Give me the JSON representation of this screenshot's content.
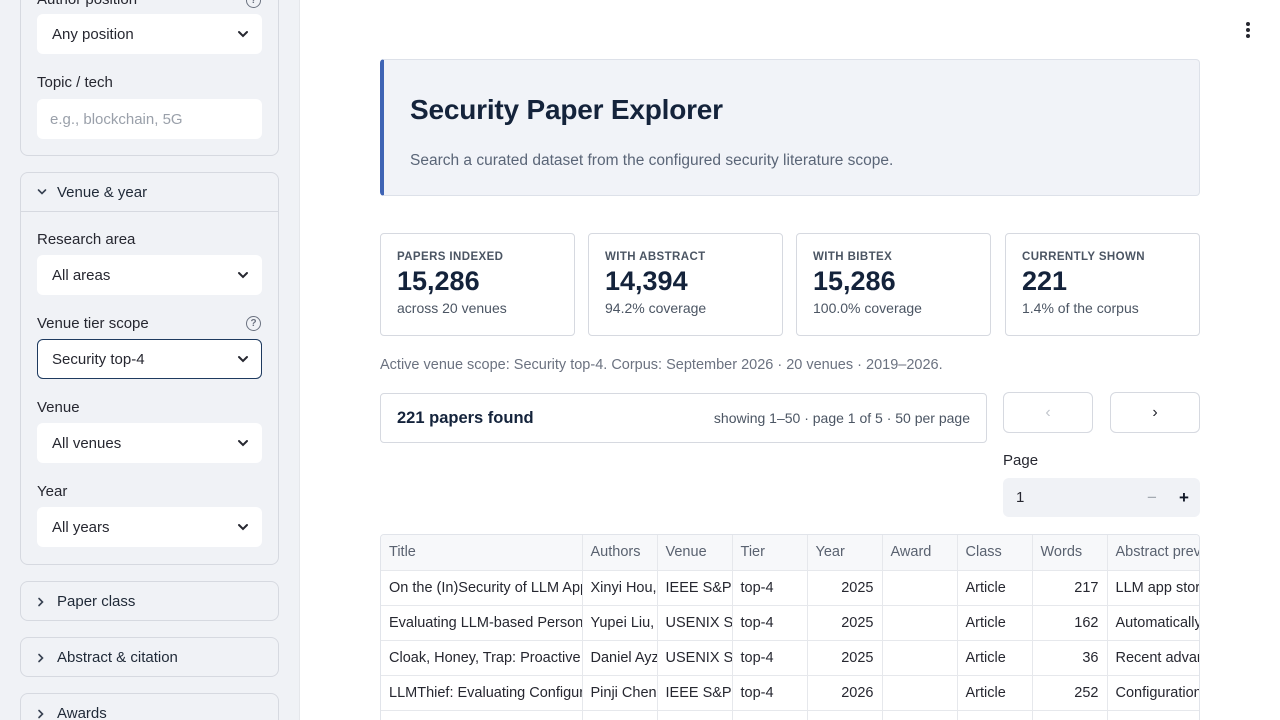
{
  "sidebar": {
    "author_position": {
      "label": "Author position",
      "value": "Any position"
    },
    "topic": {
      "label": "Topic / tech",
      "placeholder": "e.g., blockchain, 5G"
    },
    "venue_year_section": {
      "label": "Venue & year"
    },
    "research_area": {
      "label": "Research area",
      "value": "All areas"
    },
    "venue_tier": {
      "label": "Venue tier scope",
      "value": "Security top-4"
    },
    "venue": {
      "label": "Venue",
      "value": "All venues"
    },
    "year": {
      "label": "Year",
      "value": "All years"
    },
    "collapsed_sections": [
      "Paper class",
      "Abstract & citation",
      "Awards"
    ]
  },
  "header": {
    "title": "Security Paper Explorer",
    "subtitle": "Search a curated dataset from the configured security literature scope."
  },
  "stats": [
    {
      "label": "PAPERS INDEXED",
      "value": "15,286",
      "sub": "across 20 venues"
    },
    {
      "label": "WITH ABSTRACT",
      "value": "14,394",
      "sub": "94.2% coverage"
    },
    {
      "label": "WITH BIBTEX",
      "value": "15,286",
      "sub": "100.0% coverage"
    },
    {
      "label": "CURRENTLY SHOWN",
      "value": "221",
      "sub": "1.4% of the corpus"
    }
  ],
  "scope_note": "Active venue scope: Security top-4. Corpus: September 2026 · 20 venues · 2019–2026.",
  "results": {
    "count": "221 papers found",
    "meta": "showing 1–50 · page 1 of 5 · 50 per page"
  },
  "pagination": {
    "prev": "‹",
    "next": "›",
    "page_label": "Page",
    "page_value": "1",
    "minus": "−",
    "plus": "+"
  },
  "table": {
    "columns": [
      "Title",
      "Authors",
      "Venue",
      "Tier",
      "Year",
      "Award",
      "Class",
      "Words",
      "Abstract preview"
    ],
    "rows": [
      [
        "On the (In)Security of LLM App Stores",
        "Xinyi Hou, Yanjie Zhao",
        "IEEE S&P",
        "top-4",
        "2025",
        "",
        "Article",
        "217",
        "LLM app stores have seen rapid growth"
      ],
      [
        "Evaluating LLM-based Personal Information Extraction",
        "Yupei Liu, Yuqi Jia",
        "USENIX Security",
        "top-4",
        "2025",
        "",
        "Article",
        "162",
        "Automatically extracting personal information"
      ],
      [
        "Cloak, Honey, Trap: Proactive Defenses Against LLM Agents",
        "Daniel Ayzenshteyn, Roy Weiss",
        "USENIX Security",
        "top-4",
        "2025",
        "",
        "Article",
        "36",
        "Recent advances in LLMs have enabled"
      ],
      [
        "LLMThief: Evaluating Configuration Leakage",
        "Pinji Chen, Xiaojun Xu",
        "IEEE S&P",
        "top-4",
        "2026",
        "",
        "Article",
        "252",
        "Configuration of LLM applications"
      ]
    ]
  },
  "colors": {
    "accent": "#3f64b5",
    "title": "#14233b",
    "sidebar_bg": "#f0f2f6",
    "active_border": "#1e3a5f"
  }
}
